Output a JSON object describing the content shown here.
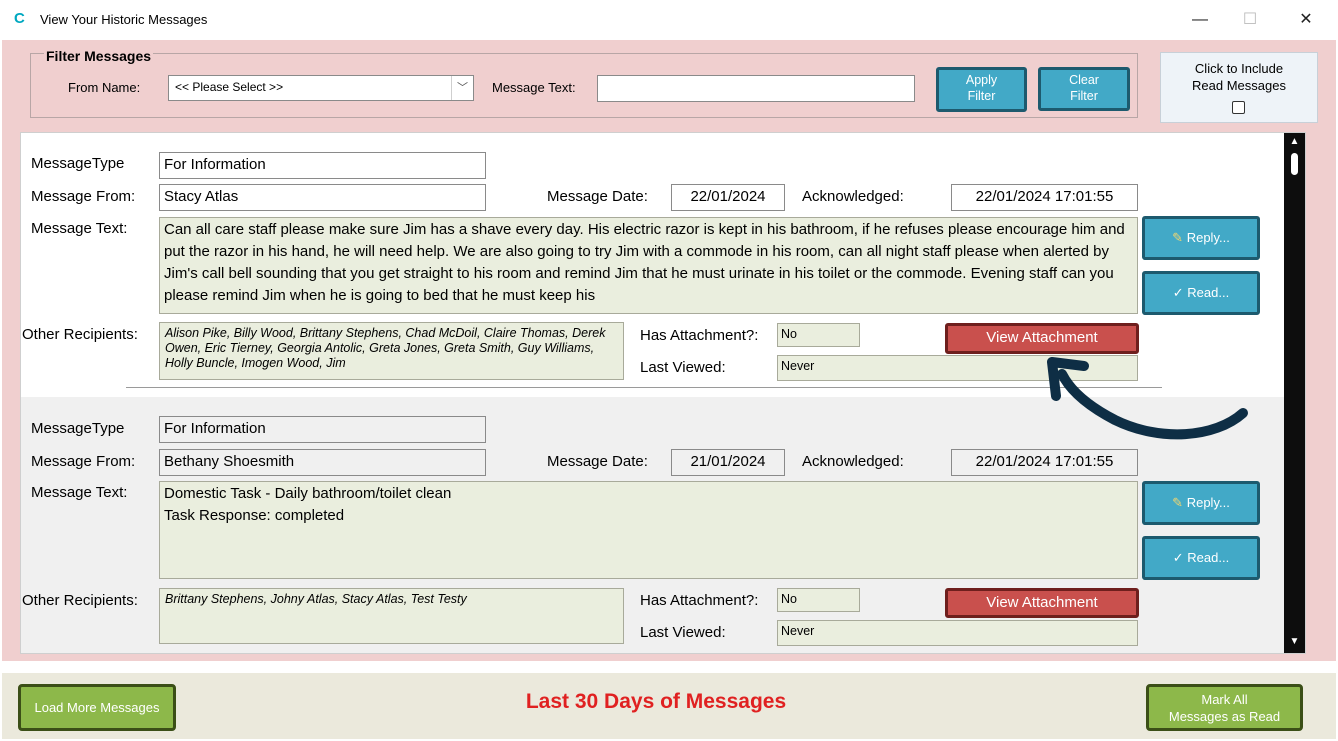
{
  "window": {
    "title": "View Your Historic Messages",
    "min_icon": "—",
    "max_icon": "☐",
    "close_icon": "✕",
    "app_icon": "C"
  },
  "filter": {
    "title": "Filter Messages",
    "from_label": "From Name:",
    "from_value": "<< Please Select >>",
    "message_text_label": "Message Text:",
    "message_text_value": "",
    "apply_label_1": "Apply",
    "apply_label_2": "Filter",
    "clear_label_1": "Clear",
    "clear_label_2": "Filter"
  },
  "include_read": {
    "line1": "Click to Include",
    "line2": "Read Messages",
    "checked": false
  },
  "labels": {
    "message_type": "MessageType",
    "message_from": "Message From:",
    "message_date": "Message Date:",
    "acknowledged": "Acknowledged:",
    "message_text": "Message Text:",
    "other_recipients": "Other Recipients:",
    "has_attachment": "Has Attachment?:",
    "last_viewed": "Last Viewed:",
    "reply": "Reply...",
    "read": "Read...",
    "view_attachment": "View Attachment"
  },
  "messages": [
    {
      "type": "For Information",
      "from": "Stacy Atlas",
      "date": "22/01/2024",
      "acknowledged": "22/01/2024 17:01:55",
      "text": "Can all care staff please make sure Jim has a shave every day. His electric razor is kept in his bathroom, if he refuses please encourage him and put the razor in his hand, he will need help. We are also going to try Jim with a commode in his room, can all night staff please when alerted by Jim's call bell sounding that you get straight to his room and remind Jim that he must urinate in his toilet or the commode. Evening staff can you please remind Jim when he is going to  bed that he must keep his",
      "recipients": "Alison Pike, Billy Wood, Brittany Stephens, Chad McDoil, Claire Thomas, Derek Owen, Eric Tierney, Georgia Antolic, Greta Jones, Greta Smith, Guy Williams, Holly Buncle, Imogen Wood, Jim",
      "has_attachment": "No",
      "last_viewed": "Never"
    },
    {
      "type": "For Information",
      "from": "Bethany Shoesmith",
      "date": "21/01/2024",
      "acknowledged": "22/01/2024 17:01:55",
      "text_line1": "Domestic Task - Daily bathroom/toilet clean",
      "text_line2": "Task Response: completed",
      "recipients": "Brittany Stephens, Johny Atlas, Stacy Atlas, Test Testy",
      "has_attachment": "No",
      "last_viewed": "Never"
    }
  ],
  "footer": {
    "load_more": "Load More Messages",
    "title": "Last 30 Days of Messages",
    "mark_all_1": "Mark All",
    "mark_all_2": "Messages as Read"
  },
  "colors": {
    "pink_bg": "#f0cfcf",
    "blue_button": "#42a9c7",
    "red_button": "#c9504d",
    "green_button": "#8db84a",
    "annotation_arrow": "#0e2e45",
    "footer_title": "#e02121"
  }
}
